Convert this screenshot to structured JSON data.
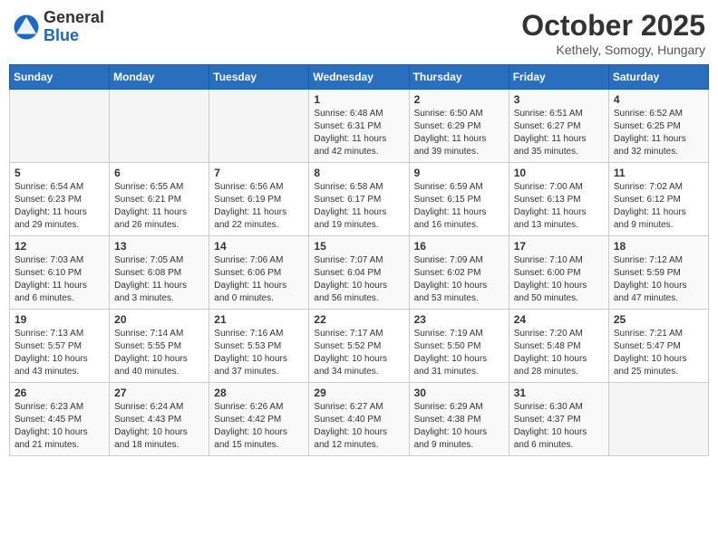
{
  "header": {
    "logo_general": "General",
    "logo_blue": "Blue",
    "title": "October 2025",
    "location": "Kethely, Somogy, Hungary"
  },
  "days_of_week": [
    "Sunday",
    "Monday",
    "Tuesday",
    "Wednesday",
    "Thursday",
    "Friday",
    "Saturday"
  ],
  "weeks": [
    [
      {
        "day": "",
        "info": ""
      },
      {
        "day": "",
        "info": ""
      },
      {
        "day": "",
        "info": ""
      },
      {
        "day": "1",
        "info": "Sunrise: 6:48 AM\nSunset: 6:31 PM\nDaylight: 11 hours\nand 42 minutes."
      },
      {
        "day": "2",
        "info": "Sunrise: 6:50 AM\nSunset: 6:29 PM\nDaylight: 11 hours\nand 39 minutes."
      },
      {
        "day": "3",
        "info": "Sunrise: 6:51 AM\nSunset: 6:27 PM\nDaylight: 11 hours\nand 35 minutes."
      },
      {
        "day": "4",
        "info": "Sunrise: 6:52 AM\nSunset: 6:25 PM\nDaylight: 11 hours\nand 32 minutes."
      }
    ],
    [
      {
        "day": "5",
        "info": "Sunrise: 6:54 AM\nSunset: 6:23 PM\nDaylight: 11 hours\nand 29 minutes."
      },
      {
        "day": "6",
        "info": "Sunrise: 6:55 AM\nSunset: 6:21 PM\nDaylight: 11 hours\nand 26 minutes."
      },
      {
        "day": "7",
        "info": "Sunrise: 6:56 AM\nSunset: 6:19 PM\nDaylight: 11 hours\nand 22 minutes."
      },
      {
        "day": "8",
        "info": "Sunrise: 6:58 AM\nSunset: 6:17 PM\nDaylight: 11 hours\nand 19 minutes."
      },
      {
        "day": "9",
        "info": "Sunrise: 6:59 AM\nSunset: 6:15 PM\nDaylight: 11 hours\nand 16 minutes."
      },
      {
        "day": "10",
        "info": "Sunrise: 7:00 AM\nSunset: 6:13 PM\nDaylight: 11 hours\nand 13 minutes."
      },
      {
        "day": "11",
        "info": "Sunrise: 7:02 AM\nSunset: 6:12 PM\nDaylight: 11 hours\nand 9 minutes."
      }
    ],
    [
      {
        "day": "12",
        "info": "Sunrise: 7:03 AM\nSunset: 6:10 PM\nDaylight: 11 hours\nand 6 minutes."
      },
      {
        "day": "13",
        "info": "Sunrise: 7:05 AM\nSunset: 6:08 PM\nDaylight: 11 hours\nand 3 minutes."
      },
      {
        "day": "14",
        "info": "Sunrise: 7:06 AM\nSunset: 6:06 PM\nDaylight: 11 hours\nand 0 minutes."
      },
      {
        "day": "15",
        "info": "Sunrise: 7:07 AM\nSunset: 6:04 PM\nDaylight: 10 hours\nand 56 minutes."
      },
      {
        "day": "16",
        "info": "Sunrise: 7:09 AM\nSunset: 6:02 PM\nDaylight: 10 hours\nand 53 minutes."
      },
      {
        "day": "17",
        "info": "Sunrise: 7:10 AM\nSunset: 6:00 PM\nDaylight: 10 hours\nand 50 minutes."
      },
      {
        "day": "18",
        "info": "Sunrise: 7:12 AM\nSunset: 5:59 PM\nDaylight: 10 hours\nand 47 minutes."
      }
    ],
    [
      {
        "day": "19",
        "info": "Sunrise: 7:13 AM\nSunset: 5:57 PM\nDaylight: 10 hours\nand 43 minutes."
      },
      {
        "day": "20",
        "info": "Sunrise: 7:14 AM\nSunset: 5:55 PM\nDaylight: 10 hours\nand 40 minutes."
      },
      {
        "day": "21",
        "info": "Sunrise: 7:16 AM\nSunset: 5:53 PM\nDaylight: 10 hours\nand 37 minutes."
      },
      {
        "day": "22",
        "info": "Sunrise: 7:17 AM\nSunset: 5:52 PM\nDaylight: 10 hours\nand 34 minutes."
      },
      {
        "day": "23",
        "info": "Sunrise: 7:19 AM\nSunset: 5:50 PM\nDaylight: 10 hours\nand 31 minutes."
      },
      {
        "day": "24",
        "info": "Sunrise: 7:20 AM\nSunset: 5:48 PM\nDaylight: 10 hours\nand 28 minutes."
      },
      {
        "day": "25",
        "info": "Sunrise: 7:21 AM\nSunset: 5:47 PM\nDaylight: 10 hours\nand 25 minutes."
      }
    ],
    [
      {
        "day": "26",
        "info": "Sunrise: 6:23 AM\nSunset: 4:45 PM\nDaylight: 10 hours\nand 21 minutes."
      },
      {
        "day": "27",
        "info": "Sunrise: 6:24 AM\nSunset: 4:43 PM\nDaylight: 10 hours\nand 18 minutes."
      },
      {
        "day": "28",
        "info": "Sunrise: 6:26 AM\nSunset: 4:42 PM\nDaylight: 10 hours\nand 15 minutes."
      },
      {
        "day": "29",
        "info": "Sunrise: 6:27 AM\nSunset: 4:40 PM\nDaylight: 10 hours\nand 12 minutes."
      },
      {
        "day": "30",
        "info": "Sunrise: 6:29 AM\nSunset: 4:38 PM\nDaylight: 10 hours\nand 9 minutes."
      },
      {
        "day": "31",
        "info": "Sunrise: 6:30 AM\nSunset: 4:37 PM\nDaylight: 10 hours\nand 6 minutes."
      },
      {
        "day": "",
        "info": ""
      }
    ]
  ]
}
